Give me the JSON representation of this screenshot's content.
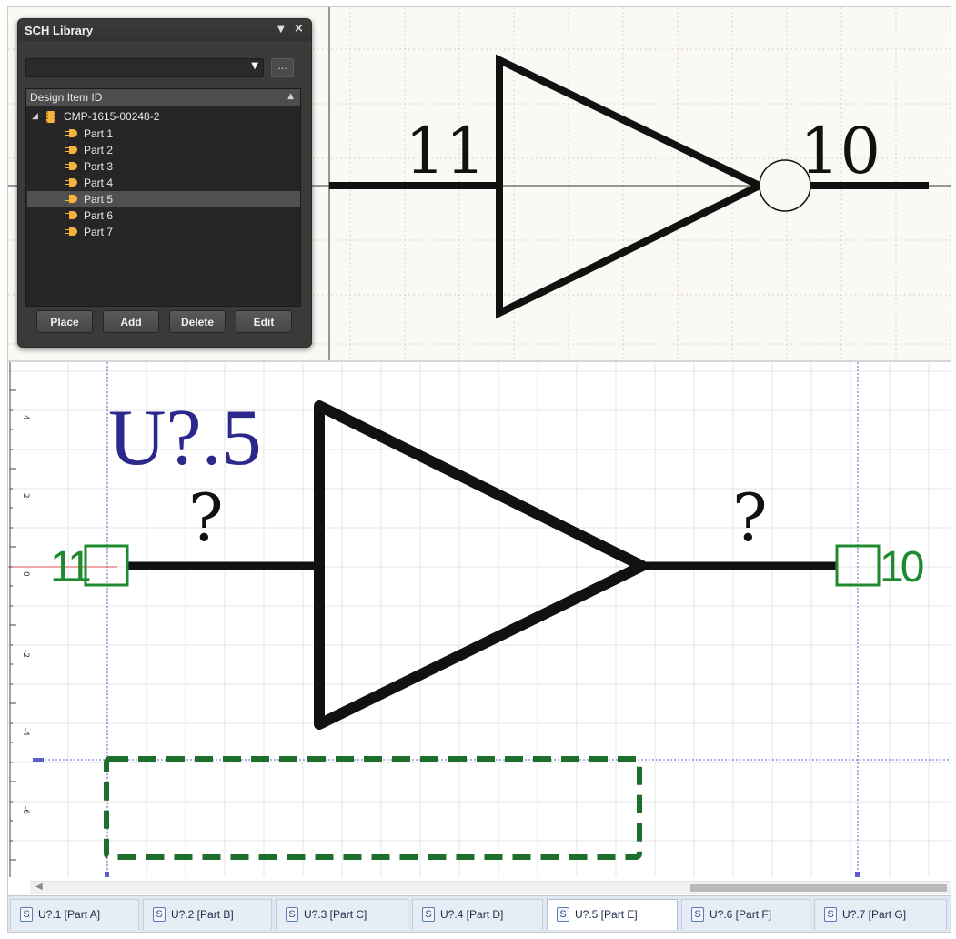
{
  "sch_library": {
    "title": "SCH Library",
    "pin_glyph": "▼",
    "close_glyph": "×",
    "filter_value": "",
    "filter_more_label": "...",
    "column_header": "Design Item ID",
    "component": "CMP-1615-00248-2",
    "parts": [
      "Part 1",
      "Part 2",
      "Part 3",
      "Part 4",
      "Part 5",
      "Part 6",
      "Part 7"
    ],
    "selected_part": "Part 5",
    "buttons": {
      "place": "Place",
      "add": "Add",
      "delete": "Delete",
      "edit": "Edit"
    }
  },
  "preview": {
    "input_pin_number": "11",
    "output_pin_number": "10"
  },
  "editor": {
    "designator": "U?.5",
    "input_pin_name": "?",
    "output_pin_name": "?",
    "input_pin_number": "11",
    "output_pin_number": "10",
    "ruler_labels": [
      "4",
      "2",
      "0",
      "-2",
      "-4",
      "-6",
      "-8"
    ]
  },
  "tabs": [
    {
      "label": "U?.1 [Part A]"
    },
    {
      "label": "U?.2 [Part B]"
    },
    {
      "label": "U?.3 [Part C]"
    },
    {
      "label": "U?.4 [Part D]"
    },
    {
      "label": "U?.5 [Part E]",
      "active": true
    },
    {
      "label": "U?.6 [Part F]"
    },
    {
      "label": "U?.7 [Part G]"
    }
  ],
  "tab_icon_glyph": "S",
  "colors": {
    "designator": "#2b2a8c",
    "pin": "#1f8a2f",
    "body_outline": "#111111",
    "dashed_box": "#1e6e2c",
    "panel_bg": "#3a3a3a",
    "accent": "#f3b33d"
  },
  "icons": [
    "pin-icon",
    "close-icon",
    "dropdown-arrow-icon",
    "sort-icon",
    "expand-icon",
    "component-icon",
    "part-icon",
    "scroll-left-icon",
    "schematic-tab-icon"
  ]
}
